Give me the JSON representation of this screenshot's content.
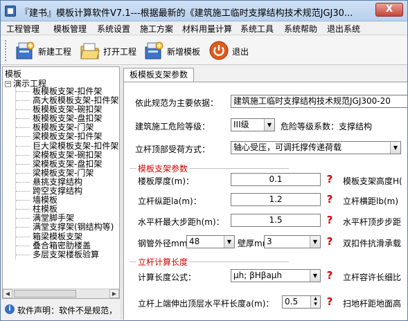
{
  "window": {
    "title": "『建书』模板计算软件V7.1---根据最新的《建筑施工临时支撑结构技术规范JGJ30...",
    "close_label": "X"
  },
  "menu": [
    "工程管理",
    "模板管理",
    "系统设置",
    "施工方案",
    "材料用量计算",
    "系统工具",
    "系统帮助",
    "退出系统"
  ],
  "toolbar": {
    "new_project": "新建工程",
    "open_project": "打开工程",
    "add_template": "新增模板",
    "exit": "退出"
  },
  "tree": {
    "caption": "模板",
    "root": "演示工程",
    "items": [
      "板模板支架-扣件架",
      "高大板模板支架-扣件架",
      "板模板支架-碗扣架",
      "板模板支架-盘扣架",
      "板模板支架-门架",
      "梁模板支架-扣件架",
      "巨大梁模板支架-扣件架",
      "梁模板支架-碗扣架",
      "梁模板支架-盘扣架",
      "梁模板支架-门架",
      "悬挑支撑结构",
      "跨空支撑结构",
      "墙模板",
      "柱模板",
      "满堂脚手架",
      "满堂支撑架(钢结构等)",
      "箱梁模板支架",
      "叠合箱密肋楼盖",
      "多层支架楼板验算"
    ]
  },
  "status": {
    "text": "软件声明：软件不是规范，"
  },
  "tab": {
    "label": "板模板支架参数"
  },
  "form": {
    "basis_label": "依此规范为主要依据：",
    "basis_value": "建筑施工临时支撑结构技术规范JGJ300-20",
    "danger_label": "建筑施工危险等级：",
    "danger_value": "III级",
    "danger_coef_label": "危险等级系数：支撑结构",
    "load_label": "立杆顶部受荷方式：",
    "load_value": "轴心受压，可调托撑传递荷载",
    "section1_title": "模板支架参数",
    "thickness_label": "楼板厚度(m)：",
    "thickness_value": "0.1",
    "height_label": "模板支架高度H(",
    "la_label": "立杆纵距la(m)：",
    "la_value": "1.2",
    "lb_label": "立杆横距lb(m)",
    "h_label": "水平杆最大步距h(m)：",
    "h_value": "1.5",
    "top_step_label": "水平杆顶步步距",
    "pipe_label": "钢管外径mm",
    "pipe_value": "48",
    "wall_label": "壁厚mm",
    "wall_value": "3",
    "double_label": "双扣件抗滑承载",
    "section2_title": "立杆计算长度",
    "calc_formula_label": "计算长度公式：",
    "calc_formula_value": "μh; βHβaμh",
    "slender_label": "立杆容许长细比",
    "extend_label": "立杆上端伸出顶层水平杆长度a(m)：",
    "extend_value": "0.5",
    "sweep_label": "扫地杆距地面高",
    "help_mark": "?"
  }
}
